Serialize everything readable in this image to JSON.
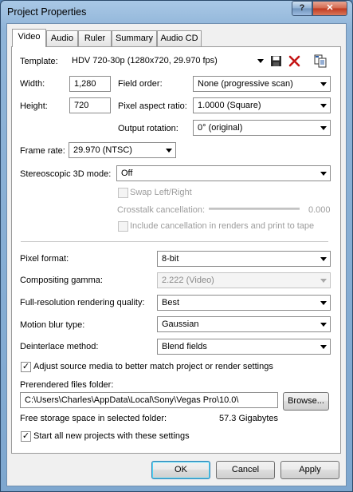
{
  "window": {
    "title": "Project Properties",
    "help_glyph": "?",
    "close_glyph": "✕"
  },
  "tabs": [
    "Video",
    "Audio",
    "Ruler",
    "Summary",
    "Audio CD"
  ],
  "template": {
    "label": "Template:",
    "value": "HDV 720-30p (1280x720, 29.970 fps)",
    "icons": [
      "save-icon",
      "delete-icon",
      "copy-icon"
    ]
  },
  "width": {
    "label": "Width:",
    "value": "1,280"
  },
  "height": {
    "label": "Height:",
    "value": "720"
  },
  "field_order": {
    "label": "Field order:",
    "value": "None (progressive scan)"
  },
  "pixel_aspect": {
    "label": "Pixel aspect ratio:",
    "value": "1.0000 (Square)"
  },
  "output_rotation": {
    "label": "Output rotation:",
    "value": "0° (original)"
  },
  "frame_rate": {
    "label": "Frame rate:",
    "value": "29.970 (NTSC)"
  },
  "stereo": {
    "label": "Stereoscopic 3D mode:",
    "value": "Off",
    "swap_label": "Swap Left/Right",
    "crosstalk_label": "Crosstalk cancellation:",
    "crosstalk_value": "0.000",
    "include_label": "Include cancellation in renders and print to tape"
  },
  "pixel_format": {
    "label": "Pixel format:",
    "value": "8-bit"
  },
  "compositing_gamma": {
    "label": "Compositing gamma:",
    "value": "2.222 (Video)"
  },
  "render_quality": {
    "label": "Full-resolution rendering quality:",
    "value": "Best"
  },
  "motion_blur": {
    "label": "Motion blur type:",
    "value": "Gaussian"
  },
  "deinterlace": {
    "label": "Deinterlace method:",
    "value": "Blend fields"
  },
  "adjust_source": {
    "label": "Adjust source media to better match project or render settings",
    "checked": true,
    "mark": "✓"
  },
  "prerendered": {
    "label": "Prerendered files folder:",
    "path": "C:\\Users\\Charles\\AppData\\Local\\Sony\\Vegas Pro\\10.0\\",
    "browse": "Browse..."
  },
  "storage": {
    "label": "Free storage space in selected folder:",
    "value": "57.3 Gigabytes"
  },
  "start_all": {
    "label": "Start all new projects with these settings",
    "checked": true,
    "mark": "✓"
  },
  "buttons": {
    "ok": "OK",
    "cancel": "Cancel",
    "apply": "Apply"
  }
}
